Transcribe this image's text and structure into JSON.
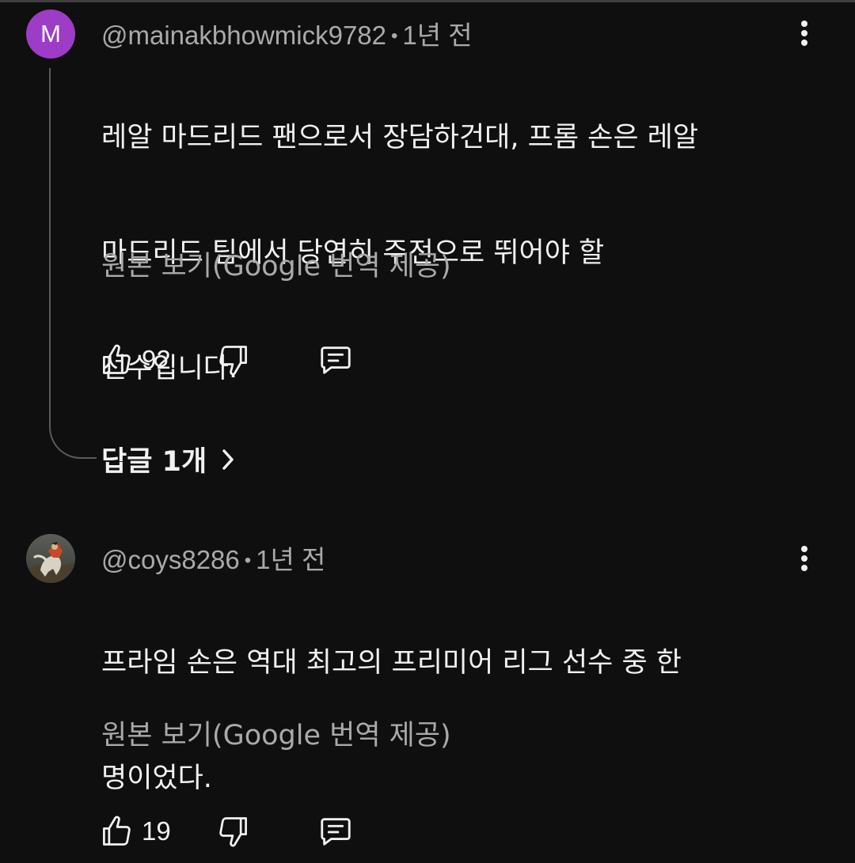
{
  "comments": [
    {
      "avatar_letter": "M",
      "avatar_color": "#9c3cc7",
      "author": "@mainakbhowmick9782",
      "separator": "•",
      "time": "1년 전",
      "text_lines": [
        "레알 마드리드 팬으로서 장담하건대, 프롬 손은 레알",
        "마드리드 팀에서 당연히 주전으로 뛰어야 할",
        "선수입니다."
      ],
      "translate_label": "원본 보기(Google 번역 제공)",
      "like_count": "92",
      "replies_label": "답글 1개",
      "icons": [
        "thumbs-up-icon",
        "thumbs-down-icon",
        "reply-icon",
        "more-vert-icon",
        "chevron-right-icon"
      ]
    },
    {
      "avatar_image": "painting-avatar",
      "author": "@coys8286",
      "separator": "•",
      "time": "1년 전",
      "text_lines": [
        "프라임 손은 역대 최고의 프리미어 리그 선수 중 한",
        "명이었다."
      ],
      "translate_label": "원본 보기(Google 번역 제공)",
      "like_count": "19",
      "icons": [
        "thumbs-up-icon",
        "thumbs-down-icon",
        "reply-icon",
        "more-vert-icon"
      ]
    }
  ],
  "colors": {
    "background": "#0f0f0f",
    "primary_text": "#f1f1f1",
    "secondary_text": "#aaaaaa",
    "thread_line": "#5a5a5a"
  }
}
